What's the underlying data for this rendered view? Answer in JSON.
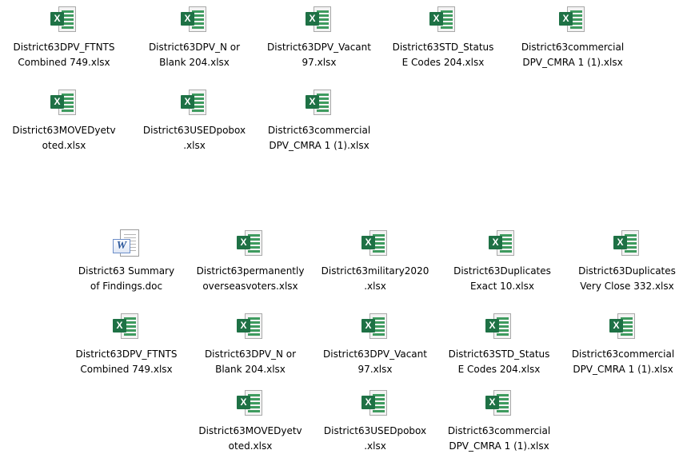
{
  "files": [
    {
      "line1": "District63DPV_FTNTS",
      "line2": "Combined 749.xlsx",
      "type": "xlsx",
      "icon": "excel-file-icon"
    },
    {
      "line1": "District63DPV_N or",
      "line2": "Blank 204.xlsx",
      "type": "xlsx",
      "icon": "excel-file-icon"
    },
    {
      "line1": "District63DPV_Vacant",
      "line2": "97.xlsx",
      "type": "xlsx",
      "icon": "excel-file-icon"
    },
    {
      "line1": "District63STD_Status",
      "line2": "E Codes 204.xlsx",
      "type": "xlsx",
      "icon": "excel-file-icon"
    },
    {
      "line1": "District63commercial",
      "line2": "DPV_CMRA 1 (1).xlsx",
      "type": "xlsx",
      "icon": "excel-file-icon"
    },
    {
      "line1": "District63MOVEDyetv",
      "line2": "oted.xlsx",
      "type": "xlsx",
      "icon": "excel-file-icon"
    },
    {
      "line1": "District63USEDpobox",
      "line2": ".xlsx",
      "type": "xlsx",
      "icon": "excel-file-icon"
    },
    {
      "line1": "District63commercial",
      "line2": "DPV_CMRA 1 (1).xlsx",
      "type": "xlsx",
      "icon": "excel-file-icon"
    },
    {
      "line1": "District63 Summary",
      "line2": "of Findings.doc",
      "type": "doc",
      "icon": "word-file-icon"
    },
    {
      "line1": "District63permanently",
      "line2": "overseasvoters.xlsx",
      "type": "xlsx",
      "icon": "excel-file-icon"
    },
    {
      "line1": "District63military2020",
      "line2": ".xlsx",
      "type": "xlsx",
      "icon": "excel-file-icon"
    },
    {
      "line1": "District63Duplicates",
      "line2": "Exact 10.xlsx",
      "type": "xlsx",
      "icon": "excel-file-icon"
    },
    {
      "line1": "District63Duplicates",
      "line2": "Very Close 332.xlsx",
      "type": "xlsx",
      "icon": "excel-file-icon"
    },
    {
      "line1": "District63DPV_FTNTS",
      "line2": "Combined 749.xlsx",
      "type": "xlsx",
      "icon": "excel-file-icon"
    },
    {
      "line1": "District63DPV_N or",
      "line2": "Blank 204.xlsx",
      "type": "xlsx",
      "icon": "excel-file-icon"
    },
    {
      "line1": "District63DPV_Vacant",
      "line2": "97.xlsx",
      "type": "xlsx",
      "icon": "excel-file-icon"
    },
    {
      "line1": "District63STD_Status",
      "line2": "E Codes 204.xlsx",
      "type": "xlsx",
      "icon": "excel-file-icon"
    },
    {
      "line1": "District63commercial",
      "line2": "DPV_CMRA 1 (1).xlsx",
      "type": "xlsx",
      "icon": "excel-file-icon"
    },
    {
      "line1": "District63MOVEDyetv",
      "line2": "oted.xlsx",
      "type": "xlsx",
      "icon": "excel-file-icon"
    },
    {
      "line1": "District63USEDpobox",
      "line2": ".xlsx",
      "type": "xlsx",
      "icon": "excel-file-icon"
    },
    {
      "line1": "District63commercial",
      "line2": "DPV_CMRA 1 (1).xlsx",
      "type": "xlsx",
      "icon": "excel-file-icon"
    }
  ],
  "icons": {
    "excel_letter": "X",
    "word_letter": "W"
  },
  "colors": {
    "excel_green": "#1e7145",
    "word_blue": "#2b579a"
  }
}
